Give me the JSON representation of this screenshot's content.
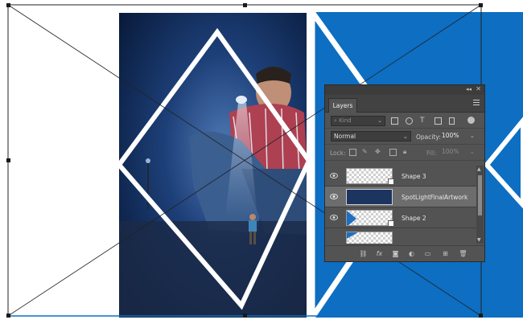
{
  "panel": {
    "collapse_glyph": "◂◂",
    "close_glyph": "✕",
    "tab_label": "Layers",
    "filter_placeholder": "Kind",
    "blend_mode": "Normal",
    "opacity_label": "Opacity:",
    "opacity_value": "100%",
    "lock_label": "Lock:",
    "fill_label": "Fill:",
    "fill_value": "100%",
    "layers": [
      {
        "name": "Shape 3",
        "selected": false
      },
      {
        "name": "SpotLightFinalArtwork",
        "selected": true
      },
      {
        "name": "Shape 2",
        "selected": false
      }
    ],
    "footer_icons": [
      "link-icon",
      "fx-icon",
      "mask-icon",
      "adjustment-icon",
      "folder-icon",
      "new-layer-icon",
      "trash-icon"
    ],
    "footer_fx_label": "fx"
  },
  "colors": {
    "canvas_blue": "#0d6ec2",
    "panel_bg": "#535353",
    "selected_row": "#6d6d6d",
    "shape_white": "#ffffff"
  }
}
